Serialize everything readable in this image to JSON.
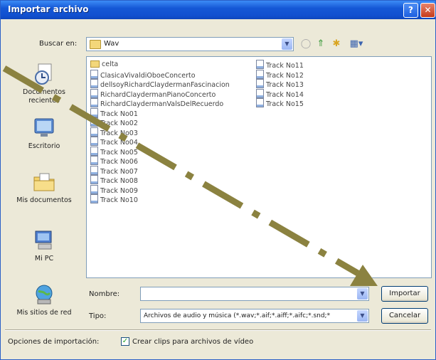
{
  "window": {
    "title": "Importar archivo"
  },
  "lookin": {
    "label": "Buscar en:",
    "value": "Wav"
  },
  "sidebar": {
    "items": [
      {
        "label": "Documentos recientes",
        "icon": "recent-documents-icon"
      },
      {
        "label": "Escritorio",
        "icon": "desktop-icon"
      },
      {
        "label": "Mis documentos",
        "icon": "my-documents-icon"
      },
      {
        "label": "Mi PC",
        "icon": "my-computer-icon"
      },
      {
        "label": "Mis sitios de red",
        "icon": "network-places-icon"
      }
    ]
  },
  "files": {
    "col1": [
      {
        "name": "celta",
        "type": "folder"
      },
      {
        "name": "ClasicaVivaldiOboeConcerto",
        "type": "audio"
      },
      {
        "name": "dellsoyRichardClaydermanFascinacion",
        "type": "audio"
      },
      {
        "name": "RichardClaydermanPianoConcerto",
        "type": "audio"
      },
      {
        "name": "RichardClaydermanValsDelRecuerdo",
        "type": "audio"
      },
      {
        "name": "Track No01",
        "type": "audio"
      },
      {
        "name": "Track No02",
        "type": "audio"
      },
      {
        "name": "Track No03",
        "type": "audio"
      },
      {
        "name": "Track No04",
        "type": "audio"
      },
      {
        "name": "Track No05",
        "type": "audio"
      },
      {
        "name": "Track No06",
        "type": "audio"
      },
      {
        "name": "Track No07",
        "type": "audio"
      },
      {
        "name": "Track No08",
        "type": "audio"
      },
      {
        "name": "Track No09",
        "type": "audio"
      },
      {
        "name": "Track No10",
        "type": "audio"
      }
    ],
    "col2": [
      {
        "name": "Track No11",
        "type": "audio"
      },
      {
        "name": "Track No12",
        "type": "audio"
      },
      {
        "name": "Track No13",
        "type": "audio"
      },
      {
        "name": "Track No14",
        "type": "audio"
      },
      {
        "name": "Track No15",
        "type": "audio"
      }
    ]
  },
  "filename": {
    "label": "Nombre:",
    "value": ""
  },
  "filetype": {
    "label": "Tipo:",
    "value": "Archivos de audio y música (*.wav;*.aif;*.aiff;*.aifc;*.snd;*"
  },
  "buttons": {
    "import": "Importar",
    "cancel": "Cancelar"
  },
  "options": {
    "label": "Opciones de importación:",
    "checkbox_label": "Crear clips para archivos de vídeo",
    "checked": true
  },
  "colors": {
    "titlebar": "#1558d6",
    "annotation_arrow": "#8b8240"
  }
}
